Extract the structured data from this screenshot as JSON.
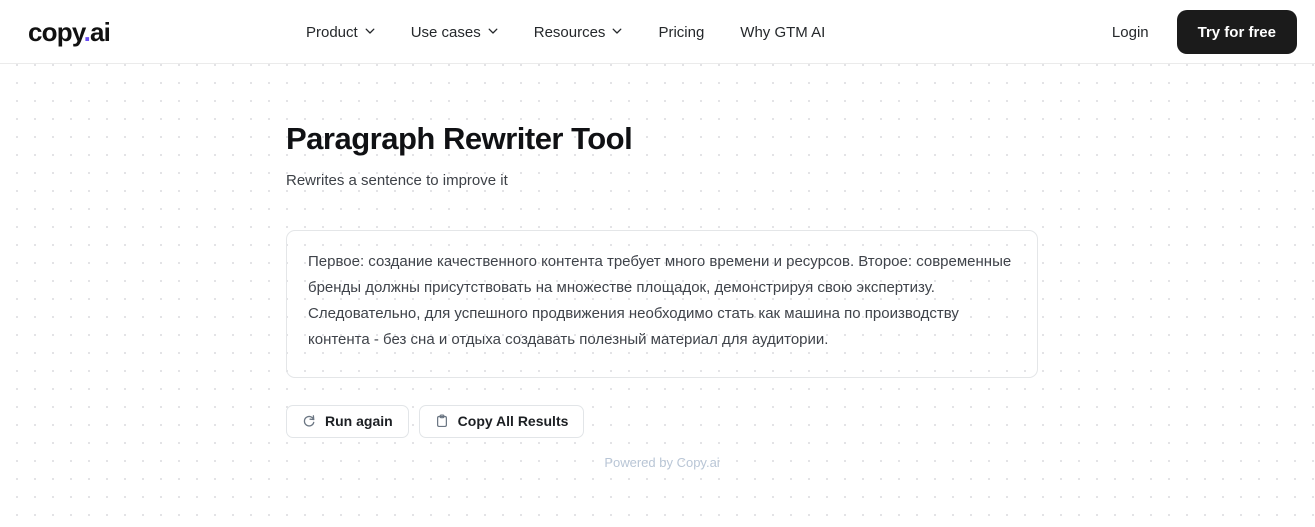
{
  "header": {
    "logo": {
      "text": "copy",
      "dot": ".",
      "suffix": "ai"
    },
    "nav": [
      {
        "label": "Product",
        "has_chevron": true,
        "icon": "chevron-down-icon"
      },
      {
        "label": "Use cases",
        "has_chevron": true,
        "icon": "chevron-down-icon"
      },
      {
        "label": "Resources",
        "has_chevron": true,
        "icon": "chevron-down-icon"
      },
      {
        "label": "Pricing",
        "has_chevron": false
      },
      {
        "label": "Why GTM AI",
        "has_chevron": false
      }
    ],
    "login_label": "Login",
    "cta_label": "Try for free"
  },
  "main": {
    "title": "Paragraph Rewriter Tool",
    "subtitle": "Rewrites a sentence to improve it",
    "result_text": "Первое: создание качественного контента требует много времени и ресурсов. Второе: современные бренды должны присутствовать на множестве площадок, демонстрируя свою экспертизу. Следовательно, для успешного продвижения необходимо стать как машина по производству контента - без сна и отдыха создавать полезный материал для аудитории.",
    "actions": [
      {
        "label": "Run again",
        "icon": "refresh-icon"
      },
      {
        "label": "Copy All Results",
        "icon": "clipboard-icon"
      }
    ],
    "powered_by": "Powered by Copy.ai"
  },
  "colors": {
    "brand_accent": "#6A4DF4",
    "cta_background": "#1b1b1b",
    "text_primary": "#101114",
    "text_secondary": "#3f434a",
    "border": "#e4e6e8",
    "dot_grid": "#e3e3e6",
    "powered_by": "#b9c6d6"
  }
}
